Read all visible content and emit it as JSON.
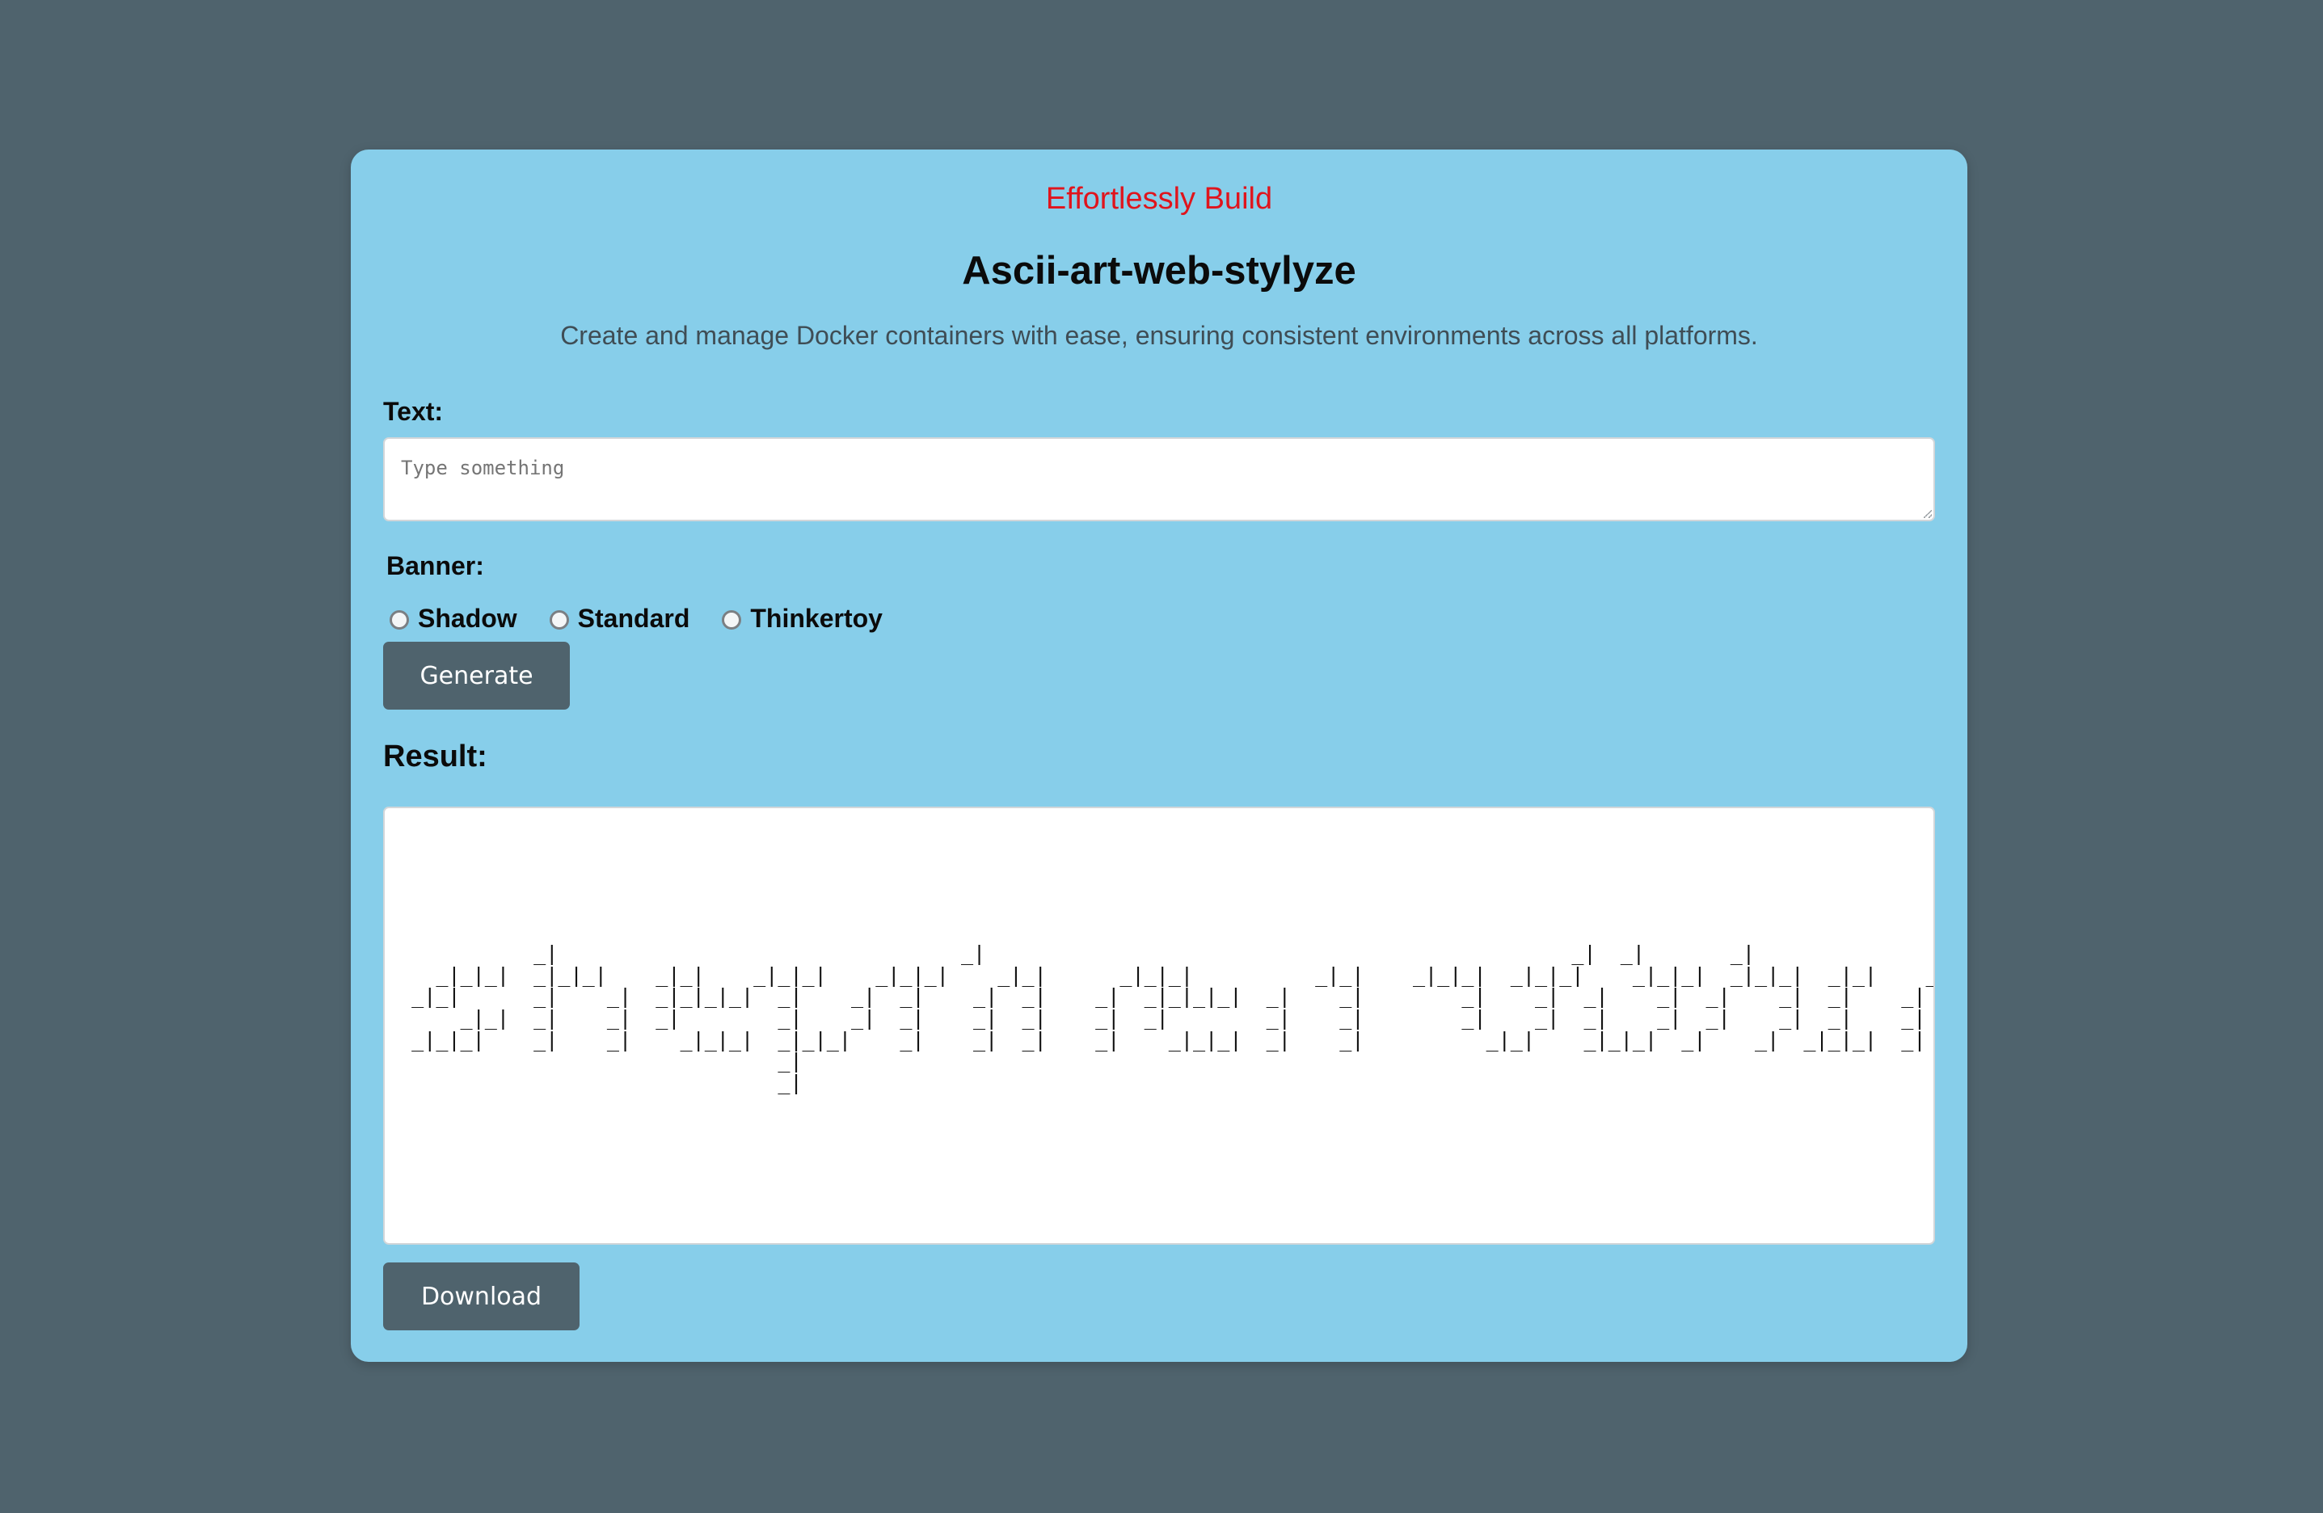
{
  "header": {
    "tagline": "Effortlessly Build",
    "title": "Ascii-art-web-stylyze",
    "subtitle": "Create and manage Docker containers with ease, ensuring consistent environments across all platforms."
  },
  "form": {
    "text_label": "Text:",
    "text_placeholder": "Type something",
    "text_value": "",
    "banner_label": "Banner:",
    "banners": [
      "Shadow",
      "Standard",
      "Thinkertoy"
    ],
    "selected_banner": null,
    "generate_label": "Generate"
  },
  "result": {
    "label": "Result:",
    "ascii": "\n\n           _|                                 _|                                                _|  _|       _|                  _|  \n   _|_|_|  _|_|_|    _|_|    _|_|_|    _|_|_|    _|_|      _|_|_|          _|_|    _|_|_|  _|_|_|    _|_|_|  _|_|_|  _|_|    _|_|_|  \n _|_|      _|    _|  _|_|_|_|  _|    _|  _|    _|  _|    _|  _|_|_|_|  _|    _|        _|    _|  _|    _|  _|    _|  _|    _|  _|    _|  _|    _|  _|    _|\n     _|_|  _|    _|  _|        _|    _|  _|    _|  _|    _|  _|        _|    _|        _|    _|  _|    _|  _|    _|  _|    _|  _|    _|  _|        _|    _|  _|    _|\n _|_|_|    _|    _|    _|_|_|  _|_|_|    _|    _|  _|    _|    _|_|_|  _|    _|          _|_|    _|_|_|  _|    _|  _|_|_|  _|        _|    _|  _|_|_|\n                               _|\n                               _|",
    "download_label": "Download"
  },
  "colors": {
    "page_background": "#4f636d",
    "card_background": "#87ceea",
    "tagline": "#e0141c",
    "button": "#4f636d"
  }
}
